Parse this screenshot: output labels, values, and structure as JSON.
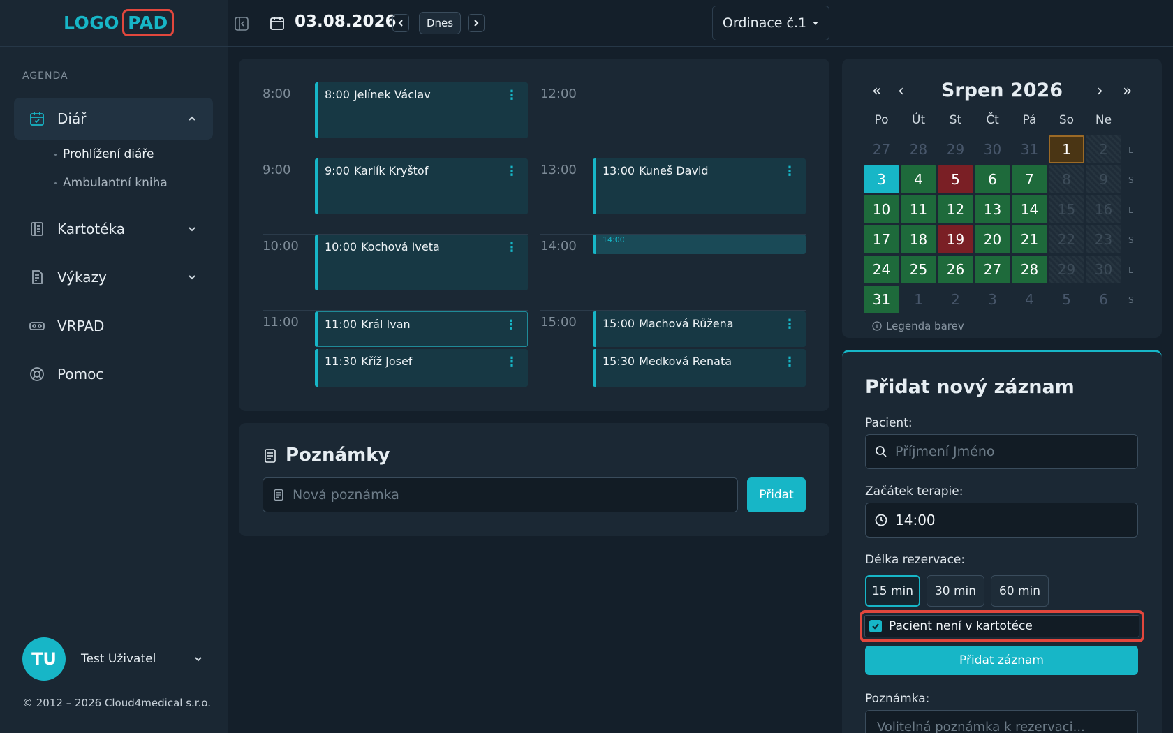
{
  "logo": {
    "part1": "LOGO",
    "part2": "PAD"
  },
  "sidebar": {
    "section_label": "AGENDA",
    "items": [
      {
        "label": "Diář"
      },
      {
        "label": "Kartotéka"
      },
      {
        "label": "Výkazy"
      },
      {
        "label": "VRPAD"
      },
      {
        "label": "Pomoc"
      }
    ],
    "subitems": [
      {
        "label": "Prohlížení diáře"
      },
      {
        "label": "Ambulantní kniha"
      }
    ]
  },
  "user": {
    "initials": "TU",
    "name": "Test Uživatel"
  },
  "copyright": "© 2012 – 2026 Cloud4medical s.r.o.",
  "topbar": {
    "date": "03.08.2026",
    "today_label": "Dnes",
    "office": "Ordinace č.1"
  },
  "schedule": {
    "left_times": [
      "8:00",
      "9:00",
      "10:00",
      "11:00"
    ],
    "right_times": [
      "12:00",
      "13:00",
      "14:00",
      "15:00"
    ],
    "appointments": [
      {
        "time": "8:00",
        "name": "Jelínek Václav"
      },
      {
        "time": "9:00",
        "name": "Karlík Kryštof"
      },
      {
        "time": "10:00",
        "name": "Kochová Iveta"
      },
      {
        "time": "11:00",
        "name": "Král Ivan"
      },
      {
        "time": "11:30",
        "name": "Kříž Josef"
      },
      {
        "time": "13:00",
        "name": "Kuneš David"
      },
      {
        "time": "15:00",
        "name": "Machová Růžena"
      },
      {
        "time": "15:30",
        "name": "Medková Renata"
      }
    ],
    "selected_slot": "14:00"
  },
  "notes": {
    "title": "Poznámky",
    "placeholder": "Nová poznámka",
    "add_label": "Přidat"
  },
  "calendar": {
    "title": "Srpen 2026",
    "nav": {
      "first": "«",
      "prev": "‹",
      "next": "›",
      "last": "»"
    },
    "weekdays": [
      "Po",
      "Út",
      "St",
      "Čt",
      "Pá",
      "So",
      "Ne"
    ],
    "weeks": [
      {
        "days": [
          "27",
          "28",
          "29",
          "30",
          "31",
          "1",
          "2"
        ],
        "type": "L"
      },
      {
        "days": [
          "3",
          "4",
          "5",
          "6",
          "7",
          "8",
          "9"
        ],
        "type": "S"
      },
      {
        "days": [
          "10",
          "11",
          "12",
          "13",
          "14",
          "15",
          "16"
        ],
        "type": "L"
      },
      {
        "days": [
          "17",
          "18",
          "19",
          "20",
          "21",
          "22",
          "23"
        ],
        "type": "S"
      },
      {
        "days": [
          "24",
          "25",
          "26",
          "27",
          "28",
          "29",
          "30"
        ],
        "type": "L"
      },
      {
        "days": [
          "31",
          "1",
          "2",
          "3",
          "4",
          "5",
          "6"
        ],
        "type": "S"
      }
    ],
    "legend": "Legenda barev",
    "colors": {
      "free": "#1e6a3b",
      "full": "#7a1f25",
      "today": "#17b6c7",
      "holiday": "#4a3514"
    }
  },
  "form": {
    "title": "Přidat nový záznam",
    "patient_label": "Pacient:",
    "patient_placeholder": "Příjmení Jméno",
    "start_label": "Začátek terapie:",
    "start_value": "14:00",
    "length_label": "Délka rezervace:",
    "lengths": [
      "15 min",
      "30 min",
      "60 min"
    ],
    "selected_length": "15 min",
    "checkbox_label": "Pacient není v kartotéce",
    "checkbox_checked": true,
    "submit_label": "Přidat záznam",
    "note_label": "Poznámka:",
    "note_placeholder": "Volitelná poznámka k rezervaci..."
  },
  "accent_color": "#17b6c7"
}
